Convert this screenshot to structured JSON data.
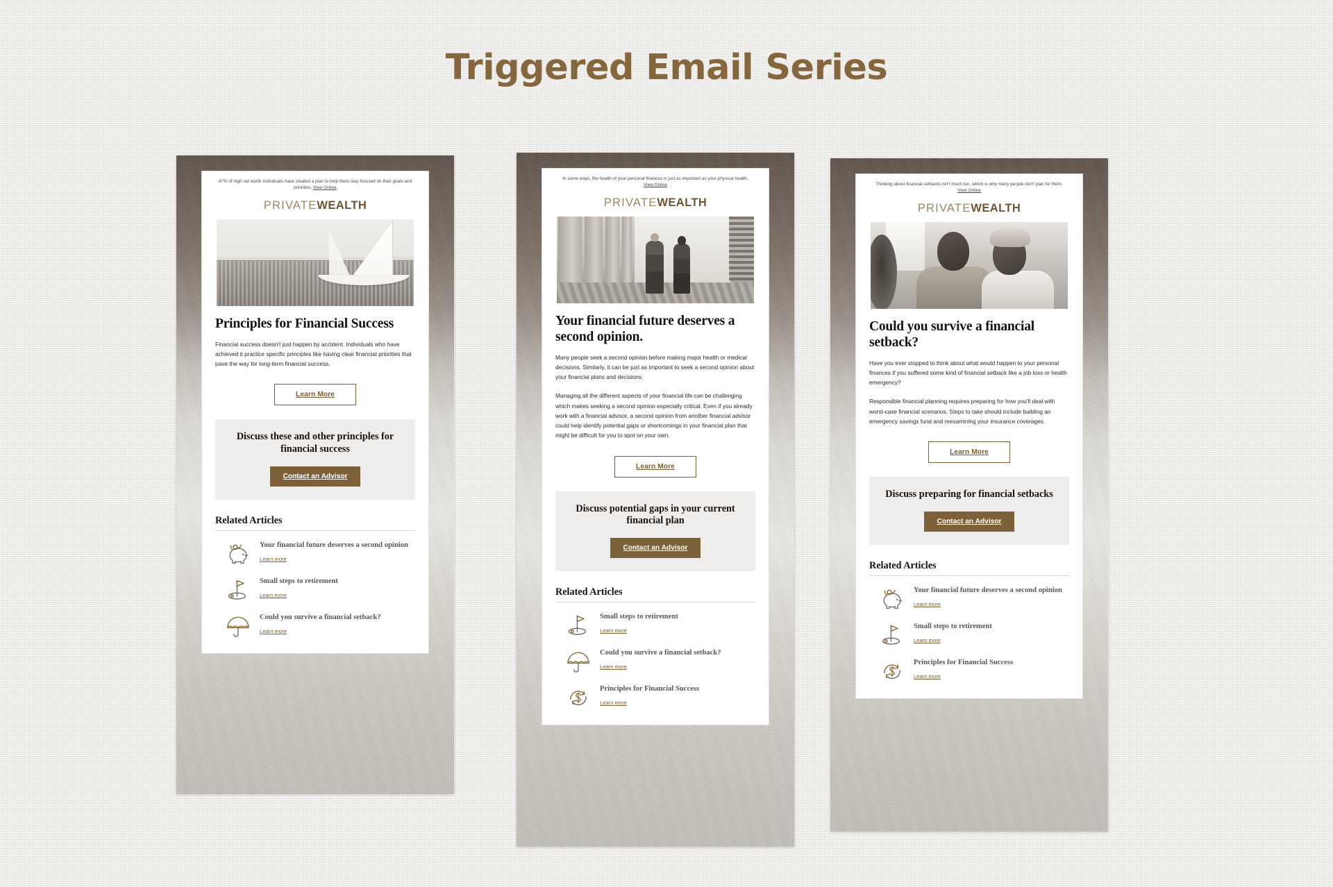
{
  "page": {
    "title": "Triggered Email Series",
    "title_color": "#86663d",
    "background_color": "#eceae6"
  },
  "brand": {
    "logo_light": "PRIVATE",
    "logo_bold": "WEALTH",
    "accent_color": "#7b5c2e",
    "solid_button_color": "#7d6038",
    "callout_background": "#eeedeb"
  },
  "emails": [
    {
      "preheader": "47% of high net worth individuals have created a plan to help them stay focused on their goals and priorities.",
      "view_online": "View Online",
      "hero_alt": "sailboat-photo",
      "headline": "Principles for Financial Success",
      "paragraphs": [
        "Financial success doesn't just happen by accident. Individuals who have achieved it practice specific principles like having clear financial priorities that pave the way for long-term financial success."
      ],
      "learn_more": "Learn More",
      "callout_title": "Discuss these and other principles for financial success",
      "contact_advisor": "Contact an Advisor",
      "related_title": "Related Articles",
      "articles": [
        {
          "icon": "piggy-bank-icon",
          "title": "Your financial future deserves a second opinion",
          "link": "Learn more"
        },
        {
          "icon": "golf-flag-icon",
          "title": "Small steps to retirement",
          "link": "Learn more"
        },
        {
          "icon": "umbrella-icon",
          "title": "Could you survive a financial setback?",
          "link": "Learn more"
        }
      ]
    },
    {
      "preheader": "In some ways, the health of your personal finances is just as important as your physical health.",
      "view_online": "View Online",
      "hero_alt": "business-couple-walking-photo",
      "headline": "Your financial future deserves a second opinion.",
      "paragraphs": [
        "Many people seek a second opinion before making major health or medical decisions. Similarly, it can be just as important to seek a second opinion about your financial plans and decisions.",
        "Managing all the different aspects of your financial life can be challenging which makes seeking a second opinion especially critical. Even if you already work with a financial advisor, a second opinion from another financial advisor could help identify potential gaps or shortcomings in your financial plan that might be difficult for you to spot on your own."
      ],
      "learn_more": "Learn More",
      "callout_title": "Discuss potential gaps in your current financial plan",
      "contact_advisor": "Contact an Advisor",
      "related_title": "Related Articles",
      "articles": [
        {
          "icon": "golf-flag-icon",
          "title": "Small steps to retirement",
          "link": "Learn more"
        },
        {
          "icon": "umbrella-icon",
          "title": "Could you survive a financial setback?",
          "link": "Learn more"
        },
        {
          "icon": "dollar-cycle-icon",
          "title": "Principles for Financial Success",
          "link": "Learn more"
        }
      ]
    },
    {
      "preheader": "Thinking about financial setbacks isn't much fun, which is why many people don't plan for them.",
      "view_online": "View Online",
      "hero_alt": "mature-couple-portrait-photo",
      "headline": "Could you survive a financial setback?",
      "paragraphs": [
        "Have you ever stopped to think about what would happen to your personal finances if you suffered some kind of financial setback like a job loss or health emergency?",
        "Responsible financial planning requires preparing for how you'll deal with worst-case financial scenarios. Steps to take should include building an emergency savings fund and reexamining your insurance coverages."
      ],
      "learn_more": "Learn More",
      "callout_title": "Discuss preparing for financial setbacks",
      "contact_advisor": "Contact an Advisor",
      "related_title": "Related Articles",
      "articles": [
        {
          "icon": "piggy-bank-icon",
          "title": "Your financial future deserves a second opinion",
          "link": "Learn more"
        },
        {
          "icon": "golf-flag-icon",
          "title": "Small steps to retirement",
          "link": "Learn more"
        },
        {
          "icon": "dollar-cycle-icon",
          "title": "Principles for Financial Success",
          "link": "Learn more"
        }
      ]
    }
  ]
}
